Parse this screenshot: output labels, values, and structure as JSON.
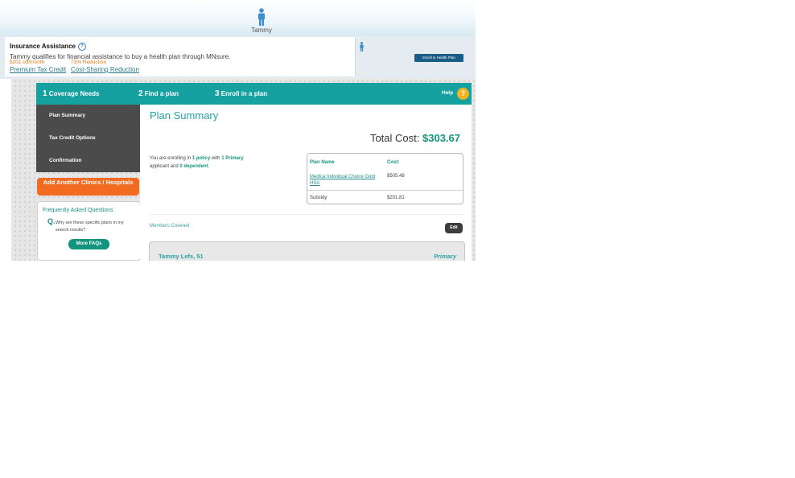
{
  "user": {
    "name": "Tammy"
  },
  "assistance": {
    "title": "Insurance Assistance",
    "help_glyph": "?",
    "description": "Tammy qualifies for financial assistance to buy a health plan through MNsure.",
    "credit_amount": "$201 off/month",
    "reduction_amount": "73% Reduction",
    "tax_credit_link": "Premium Tax Credit",
    "cost_sharing_link": "Cost-Sharing Reduction",
    "enroll_button": "Enroll in Health Plan"
  },
  "steps": [
    {
      "num": "1",
      "label": "Coverage Needs"
    },
    {
      "num": "2",
      "label": "Find a plan"
    },
    {
      "num": "3",
      "label": "Enroll in a plan"
    }
  ],
  "help": {
    "label": "Help",
    "glyph": "?"
  },
  "sidebar": {
    "items": [
      {
        "label": "Plan Summary"
      },
      {
        "label": "Tax Credit Options"
      },
      {
        "label": "Confirmation"
      }
    ],
    "add_clinics_button": "Add Another Clinics / Hospitals",
    "faq": {
      "title": "Frequently Asked Questions",
      "q_glyph": "Q.",
      "question": "Why are these specific plans in my search results?",
      "more_button": "More FAQs"
    }
  },
  "summary": {
    "title": "Plan Summary",
    "total_label": "Total Cost:",
    "total_value": "$303.67",
    "enroll": {
      "prefix": "You are enrolling in",
      "policy": "1 policy",
      "with": "with",
      "primary": "1 Primary",
      "applicant_and": "applicant and",
      "dependent": "0 dependent",
      "end": "."
    },
    "plan_card": {
      "header_name": "Plan Name",
      "header_cost": "Cost:",
      "plan_name": "Medica Individual Choice Gold HSA",
      "plan_cost": "$505.48",
      "subsidy_label": "Subsidy",
      "subsidy_value": "$201.81"
    },
    "members_label": "Members Covered",
    "edit_button": "Edit",
    "member": {
      "name": "Tammy Lefs, 51",
      "role": "Primary"
    }
  },
  "colors": {
    "teal": "#16a1a1",
    "orange": "#f26b21",
    "green": "#13957d",
    "dark_nav": "#4b4b4b",
    "enroll_blue": "#1a5e86"
  }
}
